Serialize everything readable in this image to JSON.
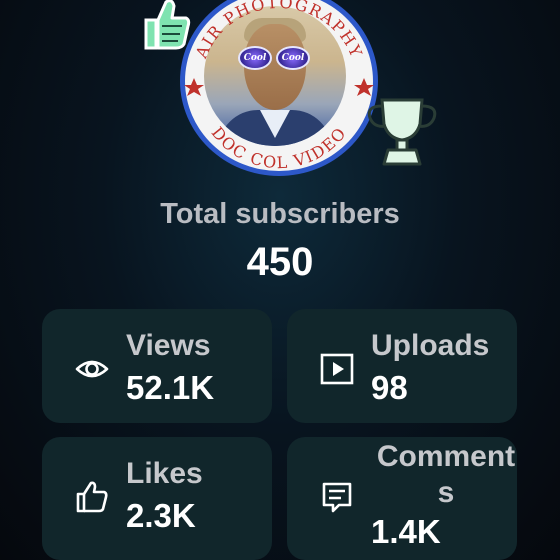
{
  "profile": {
    "ring_text_top": "AIR PHOTOGRAPHY",
    "ring_text_bottom": "DOC COL VIDEO",
    "glasses_left": "Cool",
    "glasses_right": "Cool",
    "accent_ring_color": "#2d58c9",
    "ring_text_color": "#c0312b"
  },
  "stickers": {
    "thumb": "thumbs-up-sticker",
    "trophy": "trophy-sticker"
  },
  "summary": {
    "label": "Total subscribers",
    "count": "450"
  },
  "stats": [
    {
      "label": "Views",
      "value": "52.1K",
      "icon": "eye-icon"
    },
    {
      "label": "Uploads",
      "value": "98",
      "icon": "play-icon"
    },
    {
      "label": "Likes",
      "value": "2.3K",
      "icon": "thumbs-up-icon"
    },
    {
      "label": "Comments",
      "value": "1.4K",
      "icon": "comment-icon"
    }
  ],
  "colors": {
    "card_bg": "#11262b",
    "label": "#c6c8cc",
    "value": "#ffffff",
    "sticker_green": "#7fe3b0"
  }
}
